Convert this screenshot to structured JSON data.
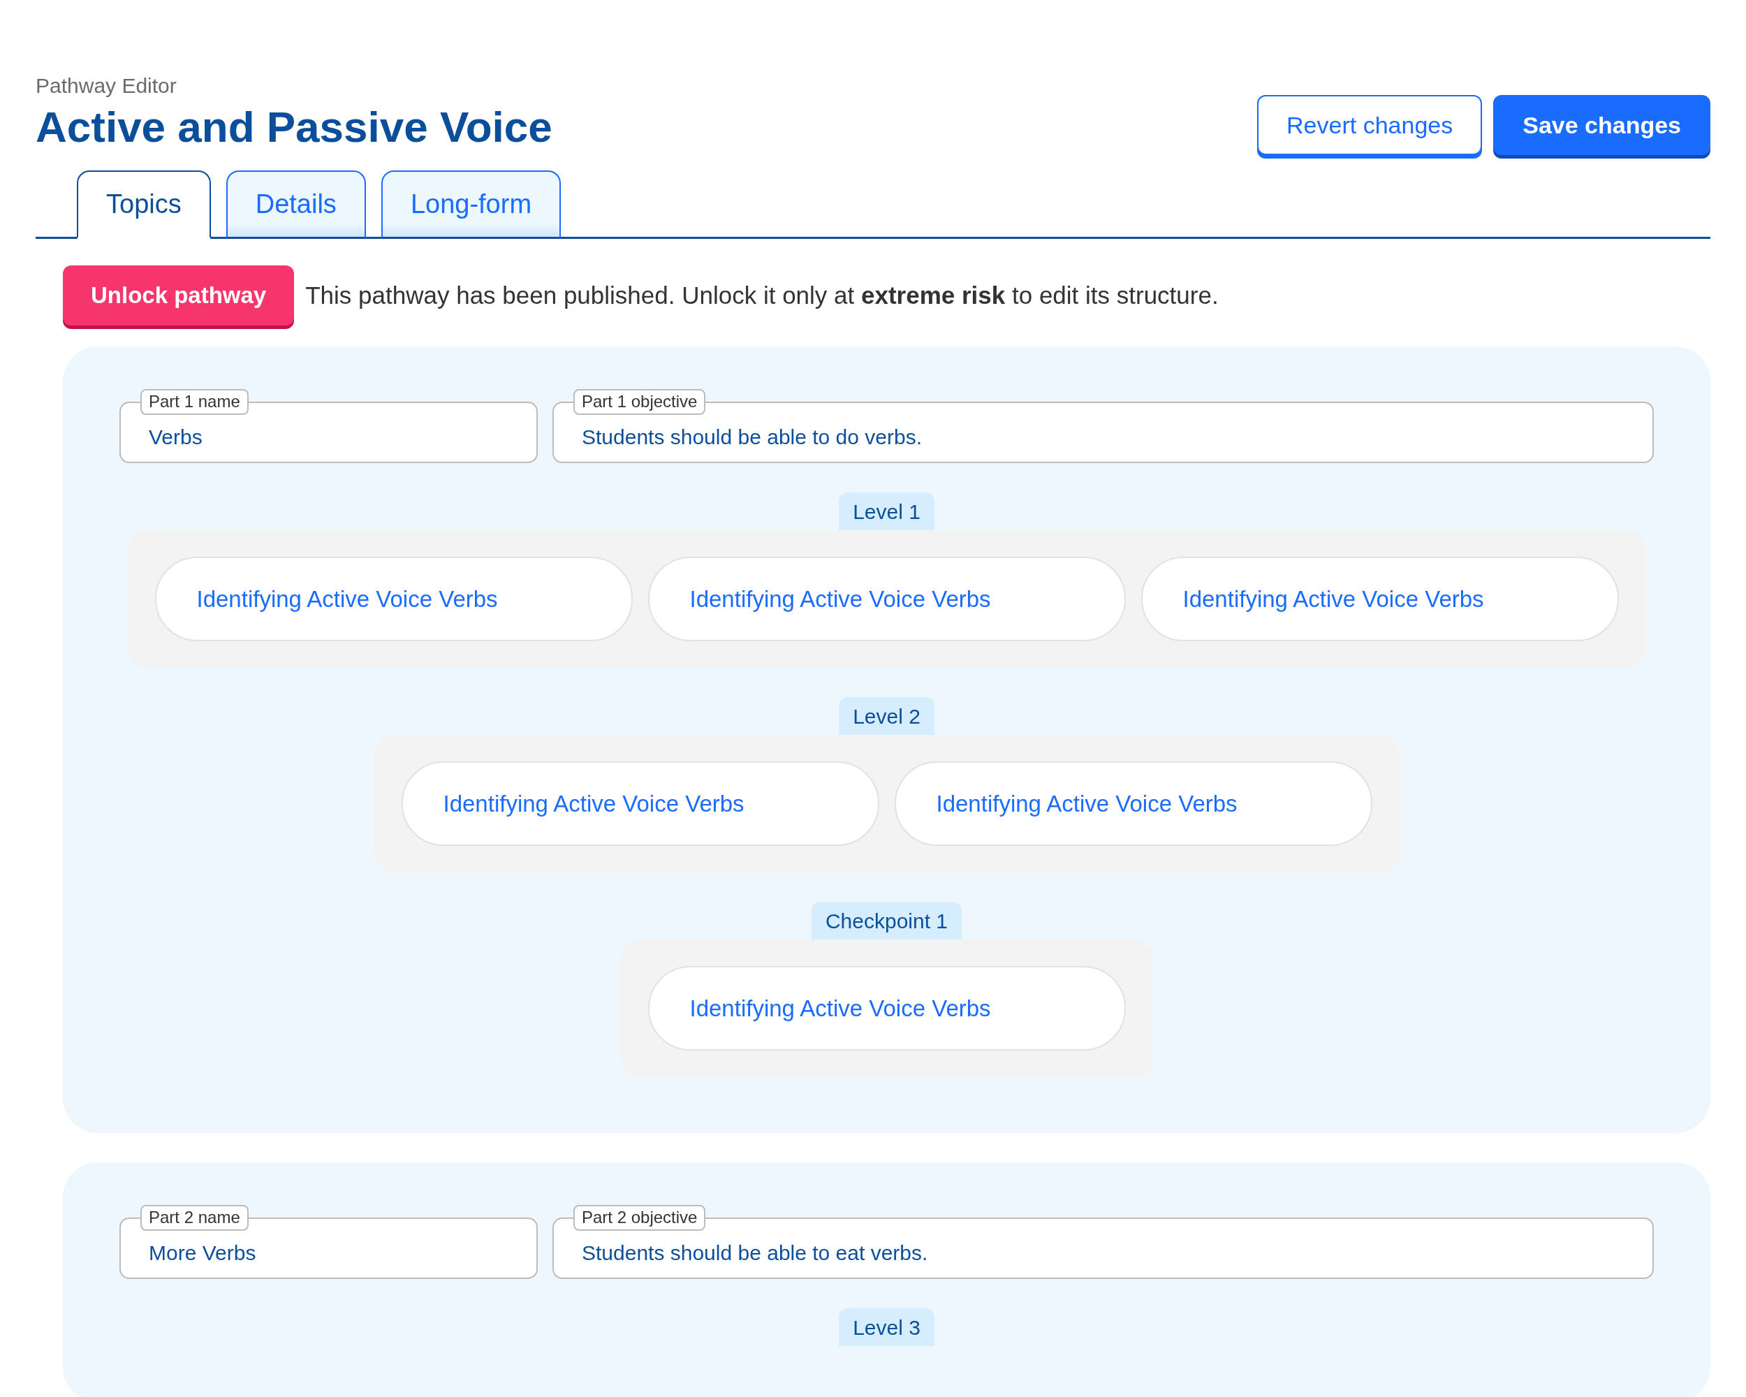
{
  "header": {
    "subtitle": "Pathway Editor",
    "title": "Active and Passive Voice"
  },
  "actions": [
    {
      "label": "Revert changes",
      "kind": "secondary"
    },
    {
      "label": "Save changes",
      "kind": "primary"
    }
  ],
  "tabs": [
    {
      "label": "Topics",
      "selected": true
    },
    {
      "label": "Details",
      "selected": false
    },
    {
      "label": "Long-form",
      "selected": false
    }
  ],
  "notice": {
    "button": "Unlock pathway",
    "text": "This pathway has been published. Unlock it only at **extreme risk** to edit its structure."
  },
  "parts": [
    {
      "name_label": "Part 1 name",
      "name_value": "Verbs",
      "objective_label": "Part 1 objective",
      "objective_value": "Students should be able to do verbs.",
      "sections": [
        {
          "label": "Level 1",
          "topics": [
            "Identifying Active Voice Verbs",
            "Identifying Active Voice Verbs",
            "Identifying Active Voice Verbs"
          ]
        },
        {
          "label": "Level 2",
          "topics": [
            "Identifying Active Voice Verbs",
            "Identifying Active Voice Verbs"
          ]
        },
        {
          "label": "Checkpoint 1",
          "topics": [
            "Identifying Active Voice Verbs"
          ]
        }
      ]
    },
    {
      "name_label": "Part 2 name",
      "name_value": "More Verbs",
      "objective_label": "Part 2 objective",
      "objective_value": "Students should be able to eat verbs.",
      "sections": [
        {
          "label": "Level 3"
        }
      ]
    }
  ]
}
